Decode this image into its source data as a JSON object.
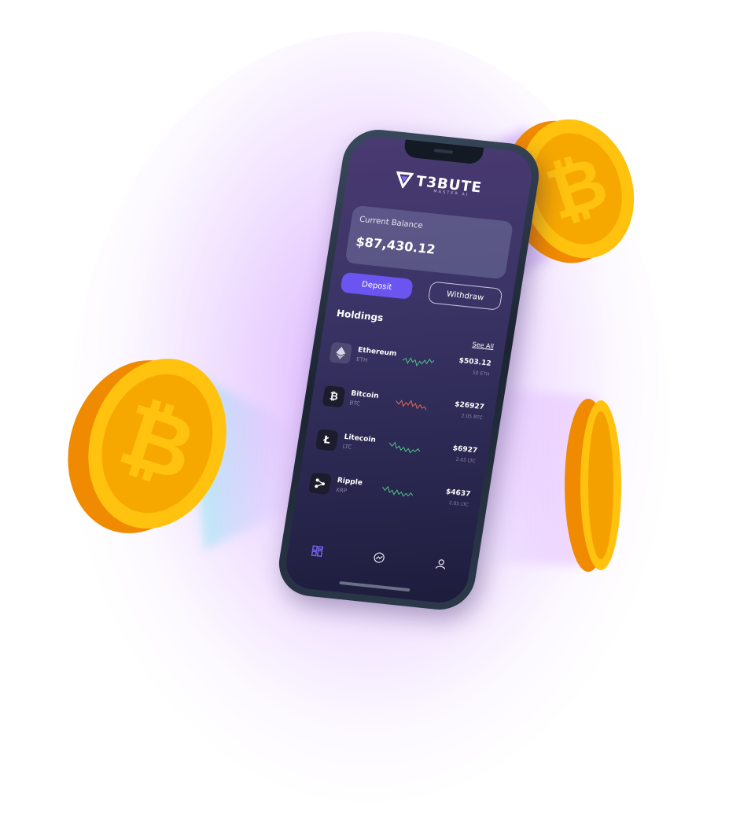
{
  "brand": {
    "name": "T3BUTE",
    "tagline": "MASTER AI"
  },
  "balance": {
    "label": "Current Balance",
    "value": "$87,430.12"
  },
  "actions": {
    "deposit_label": "Deposit",
    "withdraw_label": "Withdraw"
  },
  "holdings": {
    "title": "Holdings",
    "see_all": "See All",
    "items": [
      {
        "name": "Ethereum",
        "ticker": "ETH",
        "price": "$503.12",
        "amount": "50 ETH",
        "icon": "ethereum-icon",
        "trend_color": "#4fc28a"
      },
      {
        "name": "Bitcoin",
        "ticker": "BTC",
        "price": "$26927",
        "amount": "2.05 BTC",
        "icon": "bitcoin-icon",
        "trend_color": "#e0665e"
      },
      {
        "name": "Litecoin",
        "ticker": "LTC",
        "price": "$6927",
        "amount": "2.05 LTC",
        "icon": "litecoin-icon",
        "trend_color": "#4fc28a"
      },
      {
        "name": "Ripple",
        "ticker": "XRP",
        "price": "$4637",
        "amount": "2.05 LTC",
        "icon": "ripple-icon",
        "trend_color": "#4fc28a"
      }
    ]
  },
  "tabs": [
    {
      "icon": "dashboard-icon"
    },
    {
      "icon": "chart-icon"
    },
    {
      "icon": "profile-icon"
    }
  ],
  "colors": {
    "accent": "#6b55f0",
    "coin": "#ffc20e",
    "coin_shadow": "#f08a00"
  }
}
